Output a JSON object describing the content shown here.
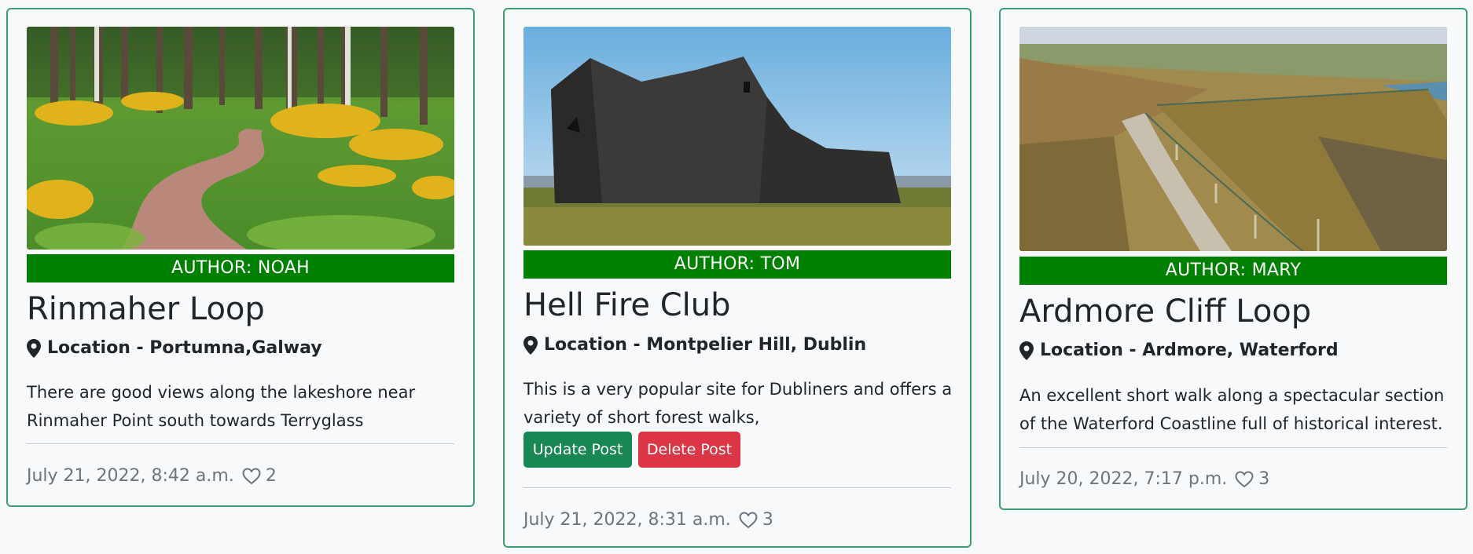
{
  "posts": [
    {
      "photo_alt": "forest-path-photo",
      "author": "AUTHOR: NOAH",
      "title": "Rinmaher Loop",
      "location": "Location - Portumna,Galway",
      "description": "There are good views along the lakeshore near Rinmaher Point south towards Terryglass",
      "date": "July 21, 2022, 8:42 a.m.",
      "likes": "2"
    },
    {
      "photo_alt": "stone-ruin-photo",
      "author": "AUTHOR: TOM",
      "title": "Hell Fire Club",
      "location": "Location - Montpelier Hill, Dublin",
      "description": "This is a very popular site for Dubliners and offers a variety of short forest walks,",
      "update_label": "Update Post",
      "delete_label": "Delete Post",
      "date": "July 21, 2022, 8:31 a.m.",
      "likes": "3"
    },
    {
      "photo_alt": "cliff-walk-photo",
      "author": "AUTHOR: MARY",
      "title": "Ardmore Cliff Loop",
      "location": "Location - Ardmore, Waterford",
      "description": "An excellent short walk along a spectacular section of the Waterford Coastline full of historical interest.",
      "date": "July 20, 2022, 7:17 p.m.",
      "likes": "3"
    }
  ],
  "icons": {
    "location": "map-pin-icon",
    "like": "heart-outline-icon"
  },
  "colors": {
    "card_border": "#3aa070",
    "author_bar": "#008000",
    "update_button": "#198754",
    "delete_button": "#dc3545",
    "muted_text": "#6c757d"
  }
}
